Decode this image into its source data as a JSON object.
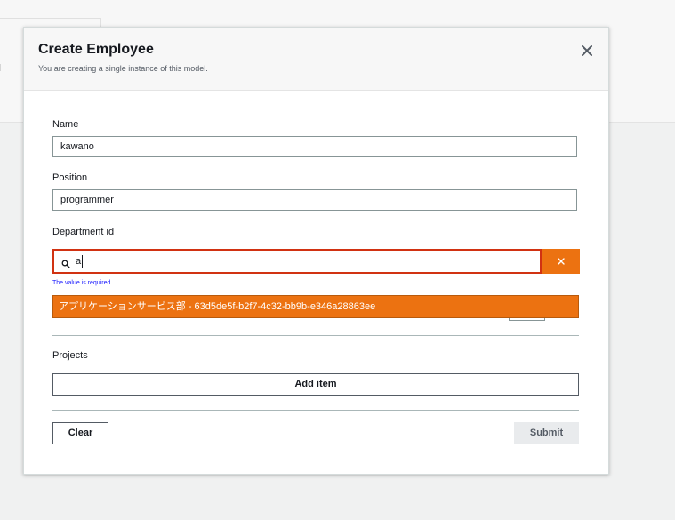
{
  "modal": {
    "title": "Create Employee",
    "subtitle": "You are creating a single instance of this model."
  },
  "form": {
    "name": {
      "label": "Name",
      "value": "kawano"
    },
    "position": {
      "label": "Position",
      "value": "programmer"
    },
    "department": {
      "label": "Department id",
      "value": "a",
      "error": "The value is required",
      "suggestion": "アプリケーションサービス部 - 63d5de5f-b2f7-4c32-bb9b-e346a28863ee"
    },
    "projects": {
      "label": "Projects",
      "add_label": "Add item"
    }
  },
  "footer": {
    "clear_label": "Clear",
    "submit_label": "Submit"
  },
  "colors": {
    "accent": "#ec7211",
    "error": "#d13212",
    "error_text": "#1a1aff"
  },
  "icons": {
    "close": "close-icon",
    "search": "search-icon",
    "clear": "clear-icon"
  }
}
